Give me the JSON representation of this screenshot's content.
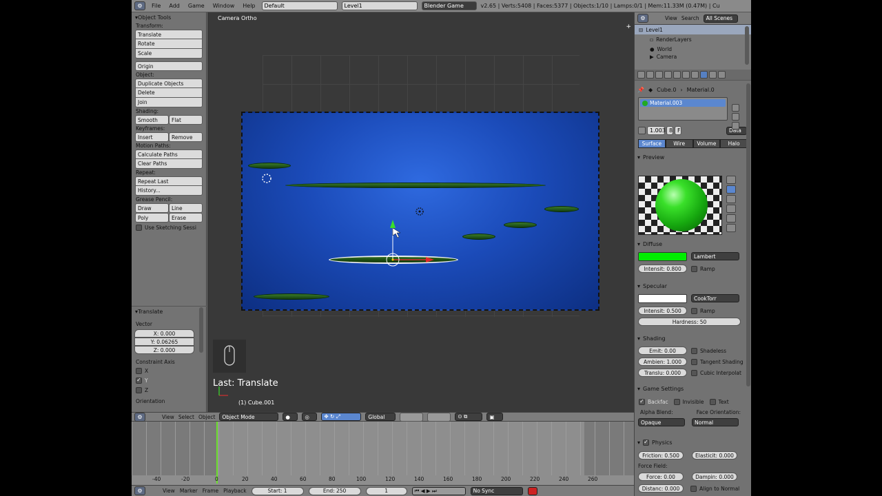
{
  "topbar": {
    "menus": [
      "File",
      "Add",
      "Game",
      "Window",
      "Help"
    ],
    "screen": "Default",
    "scene": "Level1",
    "engine": "Blender Game",
    "stats": "v2.65 | Verts:5408 | Faces:5377 | Objects:1/10 | Lamps:0/1 | Mem:11.33M (0.47M) | Cu"
  },
  "toolshelf": {
    "title": "Object Tools",
    "transform_label": "Transform:",
    "translate": "Translate",
    "rotate": "Rotate",
    "scale": "Scale",
    "origin": "Origin",
    "object_label": "Object:",
    "duplicate": "Duplicate Objects",
    "delete": "Delete",
    "join": "Join",
    "shading_label": "Shading:",
    "smooth": "Smooth",
    "flat": "Flat",
    "keyframes_label": "Keyframes:",
    "insert": "Insert",
    "remove": "Remove",
    "motion_label": "Motion Paths:",
    "calc_paths": "Calculate Paths",
    "clear_paths": "Clear Paths",
    "repeat_label": "Repeat:",
    "repeat_last": "Repeat Last",
    "history": "History...",
    "grease_label": "Grease Pencil:",
    "draw": "Draw",
    "line": "Line",
    "poly": "Poly",
    "erase": "Erase",
    "sketch": "Use Sketching Sessi"
  },
  "operator": {
    "title": "Translate",
    "vector_label": "Vector",
    "x": "X: 0.000",
    "y": "Y: 0.06265",
    "z": "Z: 0.000",
    "constraint_label": "Constraint Axis",
    "ax": "X",
    "ay": "Y",
    "az": "Z",
    "orientation": "Orientation"
  },
  "viewport": {
    "title": "Camera Ortho",
    "last_op": "Last: Translate",
    "object_name": "(1) Cube.001"
  },
  "viewhdr": {
    "view": "View",
    "select": "Select",
    "object": "Object",
    "mode": "Object Mode",
    "orientation": "Global"
  },
  "timeline": {
    "ticks": [
      "-40",
      "-20",
      "0",
      "20",
      "40",
      "60",
      "80",
      "100",
      "120",
      "140",
      "160",
      "180",
      "200",
      "220",
      "240",
      "260"
    ],
    "view": "View",
    "marker": "Marker",
    "frame": "Frame",
    "playback": "Playback",
    "start": "Start: 1",
    "end": "End: 250",
    "current": "1",
    "sync": "No Sync"
  },
  "outliner": {
    "view": "View",
    "search": "Search",
    "scenes": "All Scenes",
    "items": [
      "Level1",
      "RenderLayers",
      "World",
      "Camera"
    ]
  },
  "props": {
    "crumb_obj": "Cube.0",
    "crumb_mat": "Material.0",
    "material": "Material.003",
    "users": "1.003",
    "fake": "F",
    "link": "Data",
    "tabs": [
      "Surface",
      "Wire",
      "Volume",
      "Halo"
    ],
    "preview": "Preview",
    "diffuse": {
      "title": "Diffuse",
      "color": "#00ee00",
      "shader": "Lambert",
      "intensity": "Intensit: 0.800",
      "ramp": "Ramp"
    },
    "specular": {
      "title": "Specular",
      "color": "#ffffff",
      "shader": "CookTorr",
      "intensity": "Intensit: 0.500",
      "ramp": "Ramp",
      "hardness": "Hardness: 50"
    },
    "shading": {
      "title": "Shading",
      "emit": "Emit: 0.00",
      "ambient": "Ambien: 1.000",
      "translucency": "Translu: 0.000",
      "shadeless": "Shadeless",
      "tangent": "Tangent Shading",
      "cubic": "Cubic Interpolat"
    },
    "game": {
      "title": "Game Settings",
      "backface": "Backfac",
      "invisible": "Invisible",
      "text": "Text",
      "alpha_label": "Alpha Blend:",
      "face_label": "Face Orientation:",
      "alpha": "Opaque",
      "face": "Normal"
    },
    "physics": {
      "title": "Physics",
      "friction": "Friction: 0.500",
      "elasticity": "Elasticit: 0.000",
      "forcefield": "Force Field:",
      "force": "Force: 0.00",
      "damping": "Dampin: 0.000",
      "distance": "Distanc: 0.000",
      "align": "Align to Normal"
    }
  }
}
